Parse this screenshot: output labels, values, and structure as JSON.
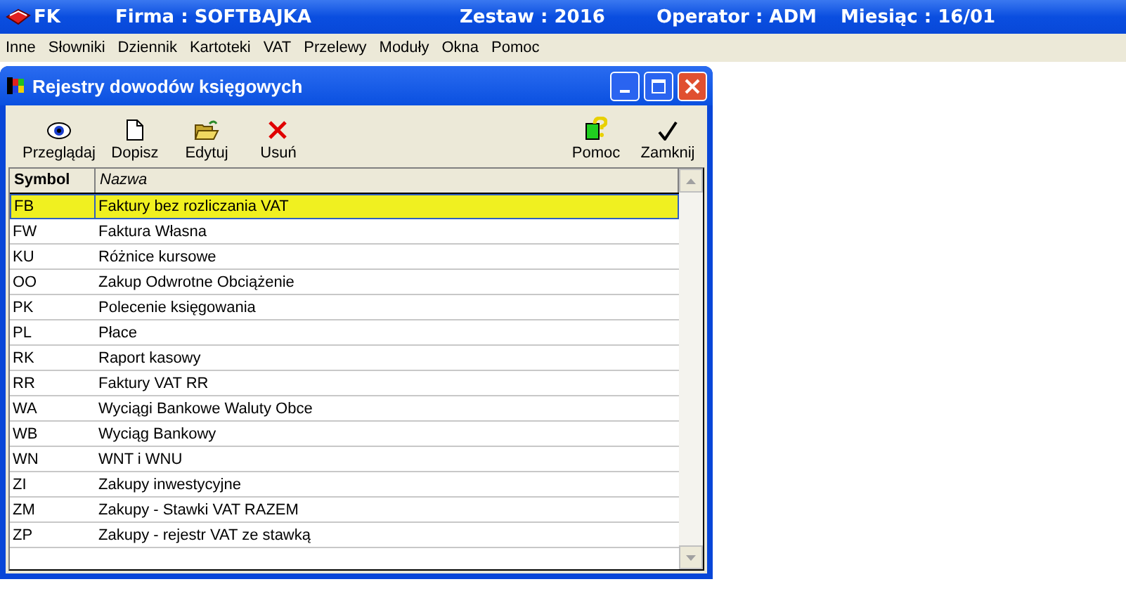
{
  "app_bar": {
    "items": [
      "FK",
      "Firma : SOFTBAJKA",
      "Zestaw : 2016",
      "Operator : ADM",
      "Miesiąc : 16/01"
    ]
  },
  "menu": [
    "Inne",
    "Słowniki",
    "Dziennik",
    "Kartoteki",
    "VAT",
    "Przelewy",
    "Moduły",
    "Okna",
    "Pomoc"
  ],
  "window": {
    "title": "Rejestry dowodów księgowych"
  },
  "toolbar": [
    {
      "kind": "view",
      "label": "Przeglądaj"
    },
    {
      "kind": "new",
      "label": "Dopisz"
    },
    {
      "kind": "edit",
      "label": "Edytuj"
    },
    {
      "kind": "delete",
      "label": "Usuń"
    },
    {
      "kind": "help",
      "label": "Pomoc"
    },
    {
      "kind": "close",
      "label": "Zamknij"
    }
  ],
  "table": {
    "columns": [
      "Symbol",
      "Nazwa"
    ],
    "rows": [
      {
        "symbol": "FB",
        "name": "Faktury bez rozliczania VAT",
        "selected": true
      },
      {
        "symbol": "FW",
        "name": "Faktura Własna",
        "selected": false
      },
      {
        "symbol": "KU",
        "name": "Różnice kursowe",
        "selected": false
      },
      {
        "symbol": "OO",
        "name": "Zakup Odwrotne Obciążenie",
        "selected": false
      },
      {
        "symbol": "PK",
        "name": "Polecenie księgowania",
        "selected": false
      },
      {
        "symbol": "PL",
        "name": "Płace",
        "selected": false
      },
      {
        "symbol": "RK",
        "name": "Raport kasowy",
        "selected": false
      },
      {
        "symbol": "RR",
        "name": "Faktury VAT RR",
        "selected": false
      },
      {
        "symbol": "WA",
        "name": "Wyciągi Bankowe Waluty Obce",
        "selected": false
      },
      {
        "symbol": "WB",
        "name": "Wyciąg Bankowy",
        "selected": false
      },
      {
        "symbol": "WN",
        "name": "WNT i WNU",
        "selected": false
      },
      {
        "symbol": "ZI",
        "name": "Zakupy inwestycyjne",
        "selected": false
      },
      {
        "symbol": "ZM",
        "name": "Zakupy - Stawki VAT RAZEM",
        "selected": false
      },
      {
        "symbol": "ZP",
        "name": "Zakupy - rejestr VAT ze stawką",
        "selected": false
      }
    ]
  }
}
